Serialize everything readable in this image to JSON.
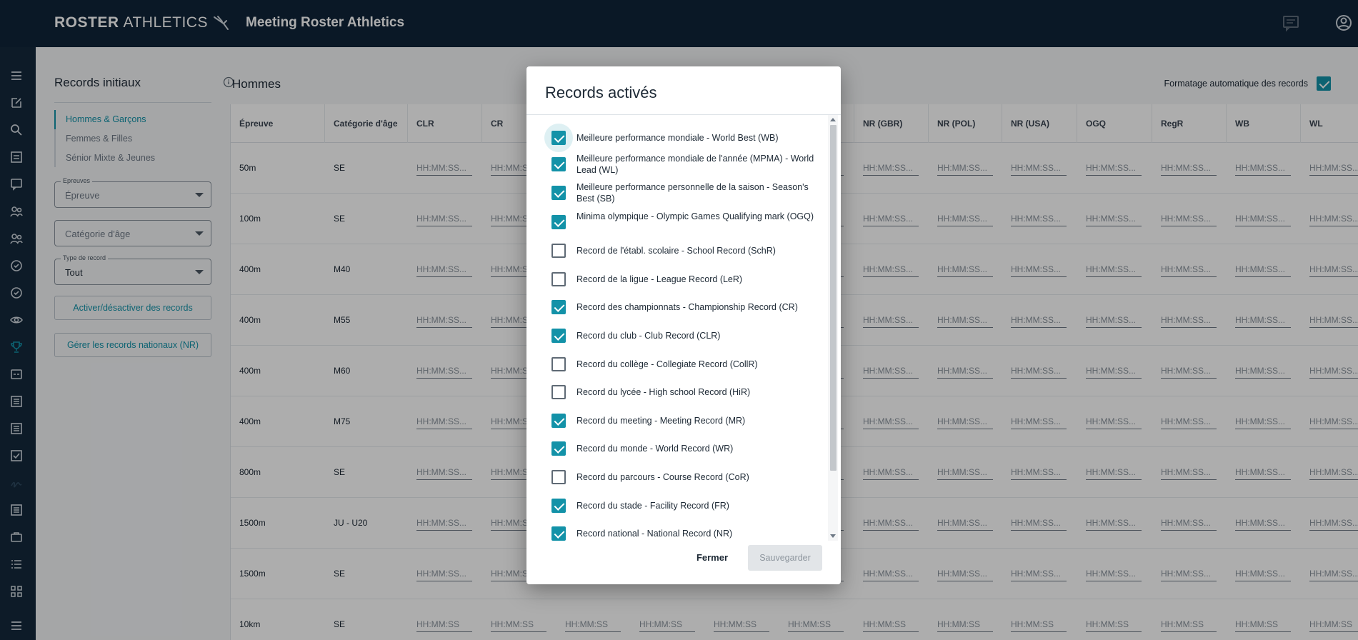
{
  "header": {
    "logo_bold": "ROSTER",
    "logo_thin": "ATHLETICS",
    "app_title": "Meeting Roster Athletics"
  },
  "left_panel": {
    "title": "Records initiaux",
    "nav": [
      "Hommes & Garçons",
      "Femmes & Filles",
      "Sénior Mixte & Jeunes"
    ],
    "epreuves_legend": "Epreuves",
    "epreuves_value": "Épreuve",
    "age_value": "Catégorie d'âge",
    "type_legend": "Type de record",
    "type_value": "Tout",
    "toggle_button": "Activer/désactiver des records",
    "nr_button": "Gérer les records nationaux (NR)"
  },
  "main": {
    "title": "Hommes",
    "auto_format_label": "Formatage automatique des records",
    "auto_format_checked": true
  },
  "table": {
    "headers": [
      "Épreuve",
      "Catégorie d'âge",
      "CLR",
      "CR",
      "",
      "",
      "",
      "",
      "NR (GBR)",
      "NR (POL)",
      "NR (USA)",
      "OGQ",
      "RegR",
      "WB",
      "WL"
    ],
    "rows": [
      {
        "event": "50m",
        "age": "SE"
      },
      {
        "event": "100m",
        "age": "SE"
      },
      {
        "event": "400m",
        "age": "M40"
      },
      {
        "event": "400m",
        "age": "M55"
      },
      {
        "event": "400m",
        "age": "M60"
      },
      {
        "event": "400m",
        "age": "M75"
      },
      {
        "event": "800m",
        "age": "SE"
      },
      {
        "event": "1500m",
        "age": "JU - U20"
      },
      {
        "event": "1500m",
        "age": "SE"
      },
      {
        "event": "10km",
        "age": "SE"
      }
    ],
    "placeholder": "HH:MM:SS...",
    "placeholder_last": "HH:MM:SS"
  },
  "modal": {
    "title": "Records activés",
    "options": [
      {
        "label": "Meilleure performance mondiale - World Best (WB)",
        "checked": true
      },
      {
        "label": "Meilleure performance mondiale de l'année (MPMA) - World Lead (WL)",
        "checked": true
      },
      {
        "label": "Meilleure performance personnelle de la saison - Season's Best (SB)",
        "checked": true
      },
      {
        "label": "Minima olympique - Olympic Games Qualifying mark (OGQ)",
        "checked": true
      },
      {
        "label": "Record de l'établ. scolaire - School Record (SchR)",
        "checked": false
      },
      {
        "label": "Record de la ligue - League Record (LeR)",
        "checked": false
      },
      {
        "label": "Record des championnats - Championship Record (CR)",
        "checked": true
      },
      {
        "label": "Record du club - Club Record (CLR)",
        "checked": true
      },
      {
        "label": "Record du collège - Collegiate Record (CollR)",
        "checked": false
      },
      {
        "label": "Record du lycée - High school Record (HiR)",
        "checked": false
      },
      {
        "label": "Record du meeting - Meeting Record (MR)",
        "checked": true
      },
      {
        "label": "Record du monde - World Record (WR)",
        "checked": true
      },
      {
        "label": "Record du parcours - Course Record (CoR)",
        "checked": false
      },
      {
        "label": "Record du stade - Facility Record (FR)",
        "checked": true
      },
      {
        "label": "Record national - National Record (NR)",
        "checked": true
      }
    ],
    "close_label": "Fermer",
    "save_label": "Sauvegarder"
  },
  "colors": {
    "topbar": "#0f2438",
    "accent": "#1392a8"
  }
}
